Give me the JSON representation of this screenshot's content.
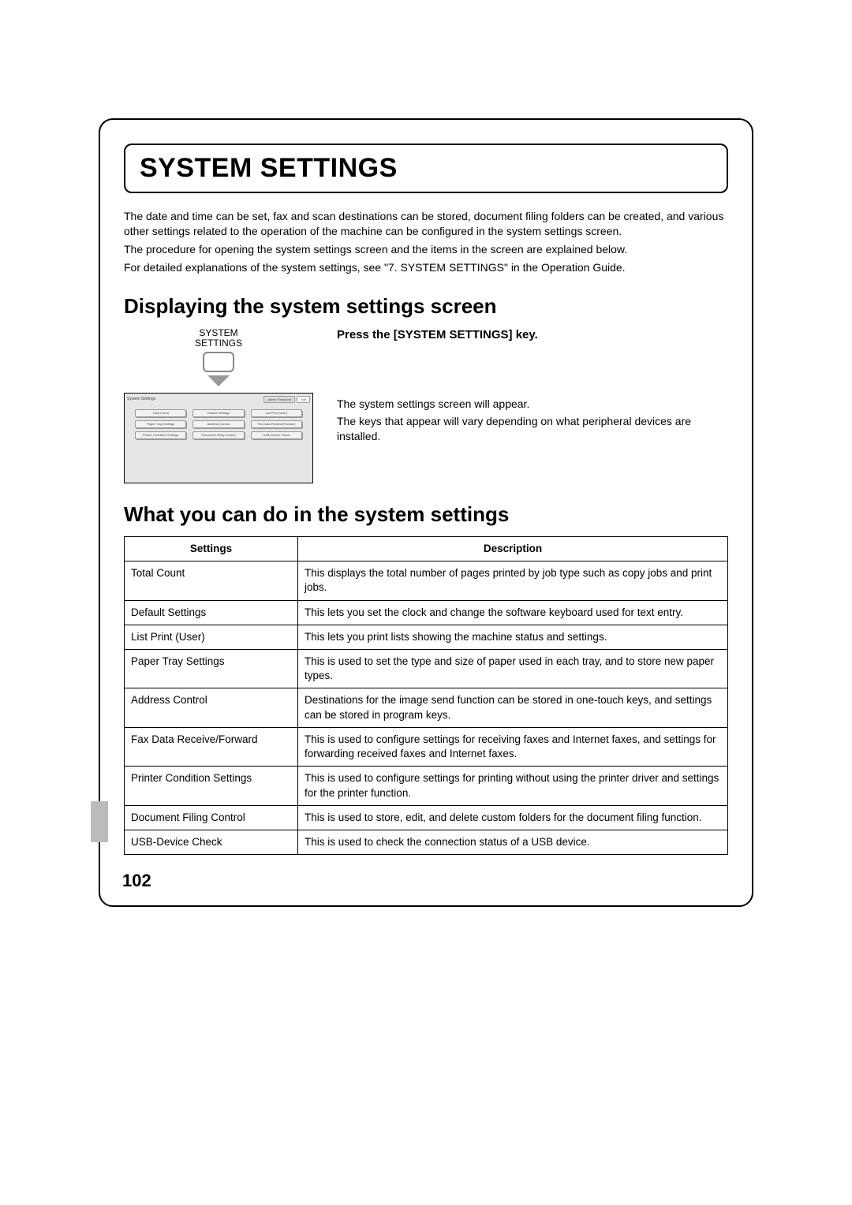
{
  "title": "SYSTEM SETTINGS",
  "intro": {
    "p1": "The date and time can be set, fax and scan destinations can be stored, document filing folders can be created, and various other settings related to the operation of the machine can be configured in the system settings screen.",
    "p2": "The procedure for opening the system settings screen and the items in the screen are explained below.",
    "p3": "For detailed explanations of the system settings, see \"7. SYSTEM SETTINGS\" in the Operation Guide."
  },
  "section1_heading": "Displaying the system settings screen",
  "keypad": {
    "label_line1": "SYSTEM",
    "label_line2": "SETTINGS"
  },
  "screen": {
    "title": "System Settings",
    "admin": "Admin Password",
    "exit": "Exit",
    "buttons": [
      "Total Count",
      "Default Settings",
      "List Print (User)",
      "Paper Tray Settings",
      "Address Control",
      "Fax Data Receive/Forward",
      "Printer Condition Settings",
      "Document Filing Control",
      "USB-Device Check"
    ]
  },
  "instruction": {
    "heading": "Press the [SYSTEM SETTINGS] key.",
    "p1": "The system settings screen will appear.",
    "p2": "The keys that appear will vary depending on what peripheral devices are installed."
  },
  "section2_heading": "What you can do in the system settings",
  "table": {
    "head_settings": "Settings",
    "head_description": "Description",
    "rows": [
      {
        "s": "Total Count",
        "d": "This displays the total number of pages printed by job type such as copy jobs and print jobs."
      },
      {
        "s": "Default Settings",
        "d": "This lets you set the clock and change the software keyboard used for text entry."
      },
      {
        "s": "List Print (User)",
        "d": "This lets you print lists showing the machine status and settings."
      },
      {
        "s": "Paper Tray Settings",
        "d": "This is used to set the type and size of paper used in each tray, and to store new paper types."
      },
      {
        "s": "Address Control",
        "d": "Destinations for the image send function can be stored in one-touch keys, and settings can be stored in program keys."
      },
      {
        "s": "Fax Data Receive/Forward",
        "d": "This is used to configure settings for receiving faxes and Internet faxes, and settings for forwarding received faxes and Internet faxes."
      },
      {
        "s": "Printer Condition Settings",
        "d": "This is used to configure settings for printing without using the printer driver and settings for the printer function."
      },
      {
        "s": "Document Filing Control",
        "d": "This is used to store, edit, and delete custom folders for the document filing function."
      },
      {
        "s": "USB-Device Check",
        "d": "This is used to check the connection status of a USB device."
      }
    ]
  },
  "page_number": "102"
}
